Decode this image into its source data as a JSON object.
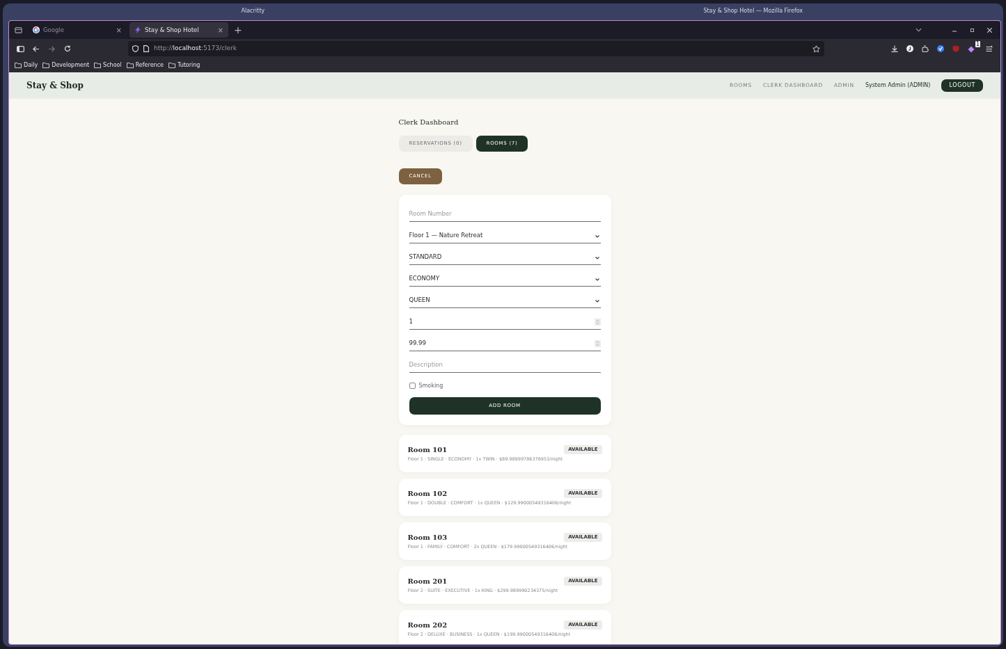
{
  "desktop": {
    "titles": [
      "Alacritty",
      "Stay & Shop Hotel — Mozilla Firefox"
    ]
  },
  "browser": {
    "tabs": [
      {
        "label": "Google",
        "selected": false,
        "close": "×"
      },
      {
        "label": "Stay & Shop Hotel",
        "selected": true,
        "close": "×"
      }
    ],
    "new_tab": "+",
    "url": {
      "scheme": "http://",
      "host": "localhost",
      "path": ":5173/clerk"
    },
    "bookmarks": [
      "Daily",
      "Development",
      "School",
      "Reference",
      "Tutoring"
    ],
    "extension_badge": "1"
  },
  "site": {
    "brand": "Stay & Shop",
    "nav": [
      {
        "label": "ROOMS"
      },
      {
        "label": "CLERK DASHBOARD"
      },
      {
        "label": "ADMIN"
      }
    ],
    "user": "System Admin (ADMIN)",
    "logout": "LOGOUT"
  },
  "dashboard": {
    "title": "Clerk Dashboard",
    "tabs": [
      {
        "label": "RESERVATIONS (0)",
        "selected": false
      },
      {
        "label": "ROOMS (7)",
        "selected": true
      }
    ],
    "cancel": "CANCEL",
    "form": {
      "fields": [
        {
          "kind": "text",
          "placeholder": "Room Number"
        },
        {
          "kind": "select",
          "value": "Floor 1 — Nature Retreat"
        },
        {
          "kind": "select",
          "value": "STANDARD"
        },
        {
          "kind": "select",
          "value": "ECONOMY"
        },
        {
          "kind": "select",
          "value": "QUEEN"
        },
        {
          "kind": "number",
          "value": "1"
        },
        {
          "kind": "number",
          "value": "99.99"
        },
        {
          "kind": "text",
          "placeholder": "Description"
        }
      ],
      "checkbox": {
        "label": "Smoking",
        "checked": false
      },
      "submit": "ADD ROOM"
    },
    "rooms": [
      {
        "name": "Room 101",
        "details": "Floor 1 · SINGLE · ECONOMY · 1x TWIN · $89.98999786376953/night",
        "status": "AVAILABLE"
      },
      {
        "name": "Room 102",
        "details": "Floor 1 · DOUBLE · COMFORT · 1x QUEEN · $129.99000549316406/night",
        "status": "AVAILABLE"
      },
      {
        "name": "Room 103",
        "details": "Floor 1 · FAMILY · COMFORT · 2x QUEEN · $179.99000549316406/night",
        "status": "AVAILABLE"
      },
      {
        "name": "Room 201",
        "details": "Floor 2 · SUITE · EXECUTIVE · 1x KING · $299.989990234375/night",
        "status": "AVAILABLE"
      },
      {
        "name": "Room 202",
        "details": "Floor 2 · DELUXE · BUSINESS · 1x QUEEN · $199.99000549316406/night",
        "status": "AVAILABLE"
      }
    ]
  }
}
